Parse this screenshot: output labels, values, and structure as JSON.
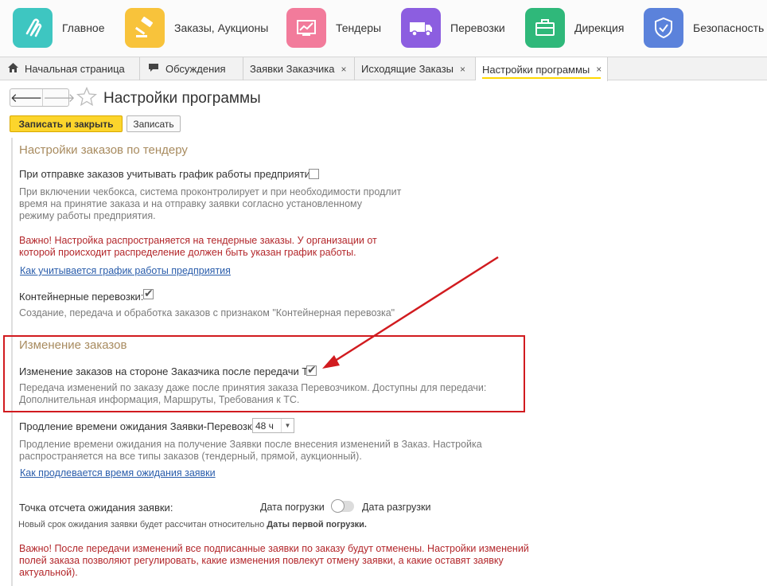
{
  "nav": {
    "items": [
      {
        "label": "Главное",
        "icon": "main-logo-icon",
        "color": "#3ec6c1"
      },
      {
        "label": "Заказы, Аукционы",
        "icon": "gavel-icon",
        "color": "#f8c33b"
      },
      {
        "label": "Тендеры",
        "icon": "chart-icon",
        "color": "#f27b9b"
      },
      {
        "label": "Перевозки",
        "icon": "truck-icon",
        "color": "#8c5ee0"
      },
      {
        "label": "Дирекция",
        "icon": "briefcase-icon",
        "color": "#2fb87a"
      },
      {
        "label": "Безопасность",
        "icon": "shield-icon",
        "color": "#5b82db"
      }
    ]
  },
  "tabs": [
    {
      "label": "Начальная страница",
      "icon": "home-icon"
    },
    {
      "label": "Обсуждения",
      "icon": "chat-icon"
    },
    {
      "label": "Заявки Заказчика",
      "close": "×"
    },
    {
      "label": "Исходящие Заказы",
      "close": "×"
    },
    {
      "label": "Настройки программы",
      "close": "×",
      "active": true
    }
  ],
  "header": {
    "back": "🡐",
    "forward": "🡒",
    "title": "Настройки программы",
    "save_close": "Записать и закрыть",
    "save": "Записать"
  },
  "tender": {
    "title": "Настройки заказов по тендеру",
    "schedule_label": "При отправке заказов учитывать график работы предприятия:",
    "schedule_checked": false,
    "schedule_hint": [
      "При включении чекбокса, система проконтролирует и при необходимости продлит",
      "время на принятие заказа и на отправку заявки согласно установленному",
      "режиму работы предприятия."
    ],
    "warning": [
      "Важно! Настройка распространяется на тендерные заказы. У организации от",
      "которой происходит распределение должен быть указан график работы."
    ],
    "schedule_link": "Как учитывается график работы предприятия",
    "container_label": "Контейнерные перевозки:",
    "container_checked": true,
    "container_hint": "Создание, передача и обработка заказов с признаком \"Контейнерная перевозка\""
  },
  "changes": {
    "title": "Изменение заказов",
    "customer_label": "Изменение заказов на стороне Заказчика после передачи ТК:",
    "customer_checked": true,
    "customer_hint": [
      "Передача изменений по заказу даже после принятия заказа Перевозчиком. Доступны для передачи:",
      "Дополнительная информация, Маршруты, Требования к ТС."
    ]
  },
  "extension": {
    "label": "Продление времени ожидания Заявки-Перевозки:",
    "value": "48 ч",
    "hint": [
      "Продление времени ожидания на получение Заявки после внесения изменений в Заказ. Настройка",
      "распространяется на все типы заказов (тендерный, прямой, аукционный)."
    ],
    "link": "Как продлевается время ожидания заявки"
  },
  "reference": {
    "label": "Точка отсчета ожидания заявки:",
    "option_load": "Дата погрузки",
    "option_unload": "Дата разгрузки",
    "note_prefix": "Новый срок ожидания заявки будет рассчитан относительно ",
    "note_bold": "Даты первой погрузки."
  },
  "final_warning": [
    "Важно! После передачи изменений все подписанные заявки по заказу будут отменены. Настройки изменений",
    "полей заказа позволяют регулировать, какие изменения повлекут отмену заявки, а какие оставят заявку",
    "актуальной)."
  ],
  "colors": {
    "accent_yellow": "#fcd52c",
    "warning_red": "#b3272b",
    "section_title": "#a88b5f",
    "link_blue": "#2a5dab",
    "annotation_red": "#d11b1f"
  }
}
